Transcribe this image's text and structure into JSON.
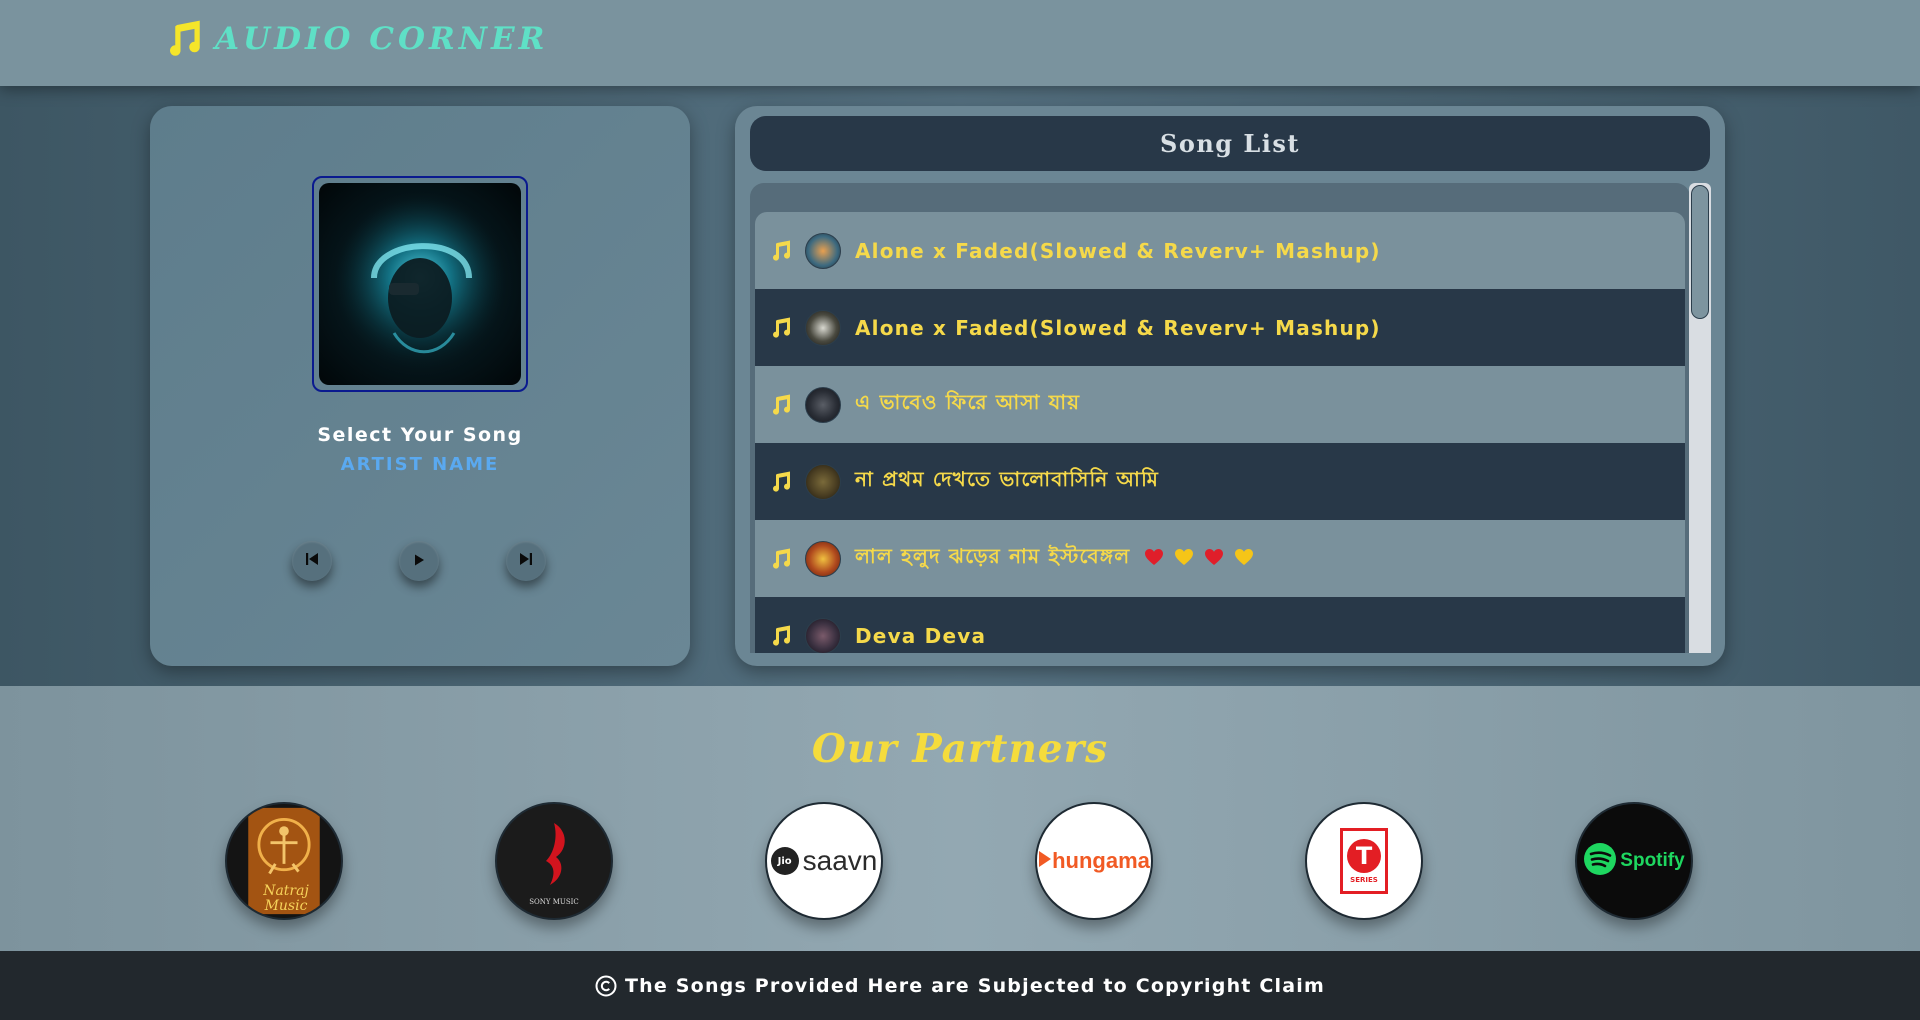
{
  "app": {
    "title": "AUDIO CORNER"
  },
  "player": {
    "song_title": "Select Your Song",
    "artist": "ARTIST NAME"
  },
  "song_list": {
    "heading": "Song List",
    "songs": [
      {
        "title": "Alone x Faded(Slowed & Reverv+ Mashup)",
        "thumb_color": "#3d6a80"
      },
      {
        "title": "Alone x Faded(Slowed & Reverv+ Mashup)",
        "thumb_color": "#4a4a40"
      },
      {
        "title": "এ ভাবেও ফিরে আসা যায়",
        "thumb_color": "#2a2e36"
      },
      {
        "title": "না প্রথম দেখতে ভালোবাসিনি আমি",
        "thumb_color": "#4a3e22"
      },
      {
        "title": "লাল হলুদ ঝড়ের নাম ইস্টবেঙ্গল",
        "thumb_color": "#b04a1e",
        "emoji": [
          "red-heart",
          "yellow-heart",
          "red-heart",
          "yellow-heart"
        ]
      },
      {
        "title": "Deva Deva",
        "thumb_color": "#3a3040"
      }
    ]
  },
  "partners": {
    "heading": "Our Partners",
    "items": [
      {
        "name": "Natraj Music",
        "logo_text": "Natraj Music"
      },
      {
        "name": "Sony Music",
        "logo_text": "SONY MUSIC"
      },
      {
        "name": "JioSaavn",
        "logo_text": "saavn"
      },
      {
        "name": "Hungama",
        "logo_text": "hungama"
      },
      {
        "name": "T-Series",
        "logo_text": "SERIES"
      },
      {
        "name": "Spotify",
        "logo_text": "Spotify"
      }
    ]
  },
  "footer": {
    "text": "The Songs Provided Here are Subjected to Copyright Claim"
  },
  "colors": {
    "accent_yellow": "#f5d94a",
    "accent_teal": "#5fe0c6",
    "artist_blue": "#5aa9f0",
    "dark_row": "#283848",
    "light_row": "#7a919c"
  }
}
